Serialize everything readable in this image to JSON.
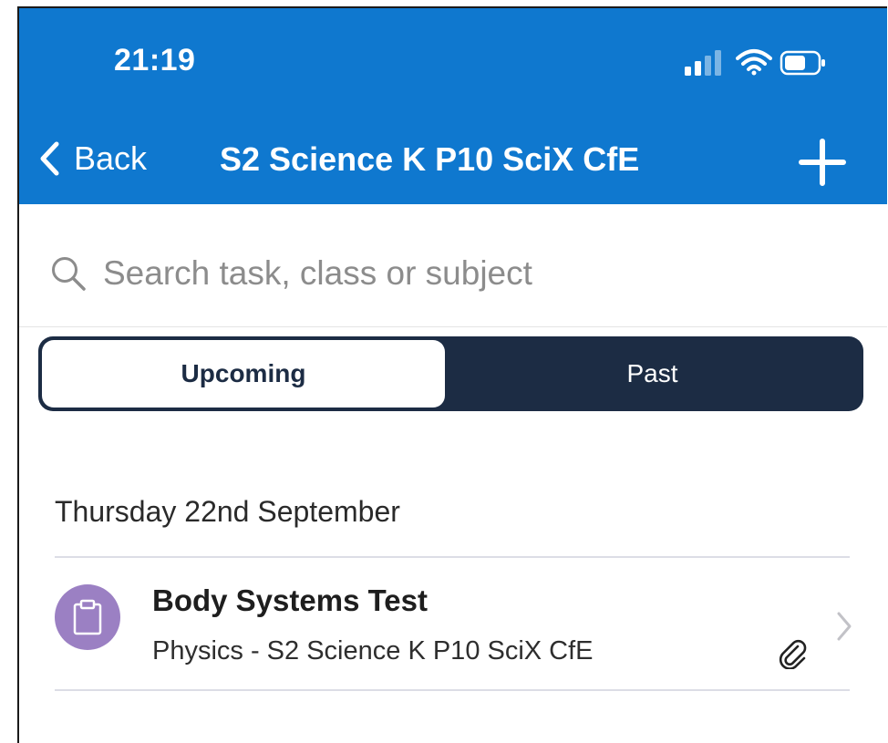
{
  "status_bar": {
    "time": "21:19",
    "icons": [
      "signal-icon",
      "wifi-icon",
      "battery-icon"
    ]
  },
  "nav": {
    "back_label": "Back",
    "title": "S2 Science K P10 SciX CfE",
    "add_icon": "plus-icon"
  },
  "search": {
    "placeholder": "Search task, class or subject",
    "value": ""
  },
  "segments": {
    "upcoming_label": "Upcoming",
    "past_label": "Past",
    "selected": "Upcoming"
  },
  "groups": [
    {
      "date": "Thursday 22nd September",
      "tasks": [
        {
          "title": "Body Systems Test",
          "subtitle": "Physics - S2 Science K P10 SciX CfE",
          "icon": "clipboard-icon",
          "has_attachment": true
        }
      ]
    }
  ],
  "colors": {
    "header_blue": "#0f78cf",
    "segment_dark": "#1c2c44",
    "badge_purple": "#9b80c3"
  }
}
